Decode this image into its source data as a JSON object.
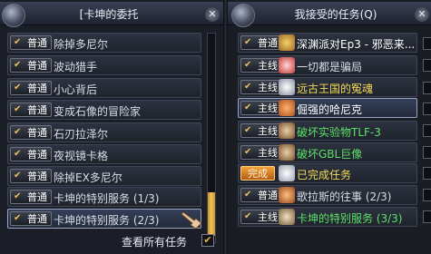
{
  "left_panel": {
    "title": "[卡坤的委托",
    "quests": [
      {
        "type": "普通",
        "name": "除掉多尼尔"
      },
      {
        "type": "普通",
        "name": "波动猎手"
      },
      {
        "type": "普通",
        "name": "小心背后"
      },
      {
        "type": "普通",
        "name": "变成石像的冒险家"
      },
      {
        "type": "普通",
        "name": "石刃拉泽尔"
      },
      {
        "type": "普通",
        "name": "夜视镜卡格"
      },
      {
        "type": "普通",
        "name": "除掉EX多尼尔"
      },
      {
        "type": "普通",
        "name": "卡坤的特别服务 (1/3)"
      },
      {
        "type": "普通",
        "name": "卡坤的特别服务 (2/3)"
      }
    ],
    "view_all_label": "查看所有任务",
    "view_all_checked": true
  },
  "right_panel": {
    "title": "我接受的任务(Q)",
    "quests": [
      {
        "type": "普通",
        "name": "深渊派对Ep3 - 邪恶来...",
        "color": "white"
      },
      {
        "type": "主线",
        "name": "一切都是骗局",
        "color": "default"
      },
      {
        "type": "主线",
        "name": "远古王国的冤魂",
        "color": "yellow"
      },
      {
        "type": "主线",
        "name": "倔强的哈尼克",
        "color": "white"
      },
      {
        "type": "主线",
        "name": "破坏实验物TLF-3",
        "color": "green"
      },
      {
        "type": "主线",
        "name": "破坏GBL巨像",
        "color": "green"
      },
      {
        "type": "完成",
        "name": "已完成任务",
        "color": "yellow"
      },
      {
        "type": "普通",
        "name": "歌拉斯的往事 (2/3)",
        "color": "default"
      },
      {
        "type": "主线",
        "name": "卡坤的特别服务 (3/3)",
        "color": "green"
      }
    ]
  },
  "colors": {
    "green_text": "#5ee06a",
    "yellow_text": "#f3dc5a",
    "complete_badge": "#f2a23a",
    "scroll_thumb": "#f3c45a"
  }
}
